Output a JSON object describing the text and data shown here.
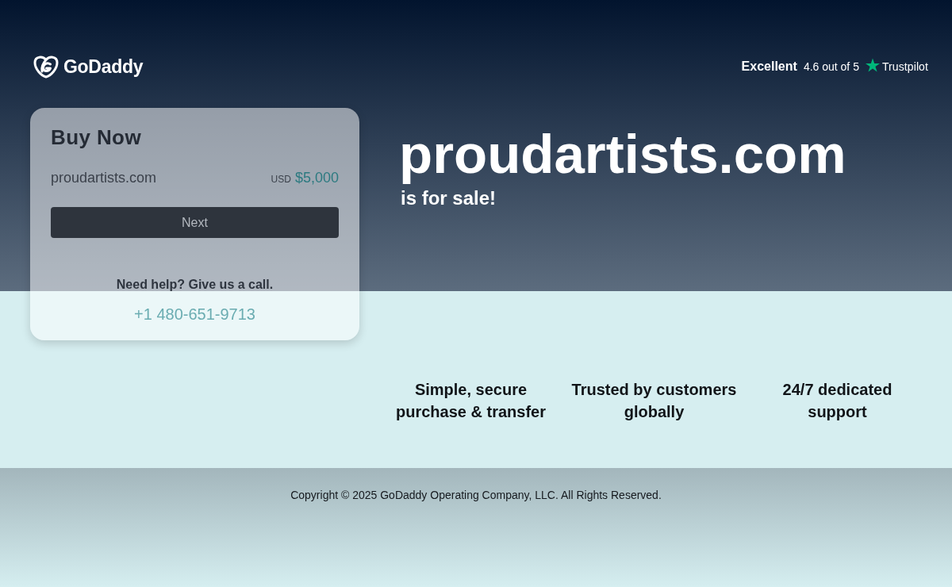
{
  "header": {
    "logo": {
      "wordmark": "GoDaddy"
    },
    "rating": {
      "verdict": "Excellent",
      "score": "4.6 out of 5",
      "brand": "Trustpilot"
    }
  },
  "buy_card": {
    "title": "Buy Now",
    "domain": "proudartists.com",
    "currency": "USD",
    "price": "$5,000",
    "button": "Next",
    "help_text": "Need help? Give us a call.",
    "phone": "+1 480-651-9713"
  },
  "hero": {
    "domain": "proudartists.com",
    "tagline": "is for sale!"
  },
  "features": [
    "Simple, secure purchase & transfer",
    "Trusted by customers globally",
    "24/7 dedicated support"
  ],
  "footer": {
    "copyright": "Copyright © 2025 GoDaddy Operating Company, LLC. All Rights Reserved."
  }
}
